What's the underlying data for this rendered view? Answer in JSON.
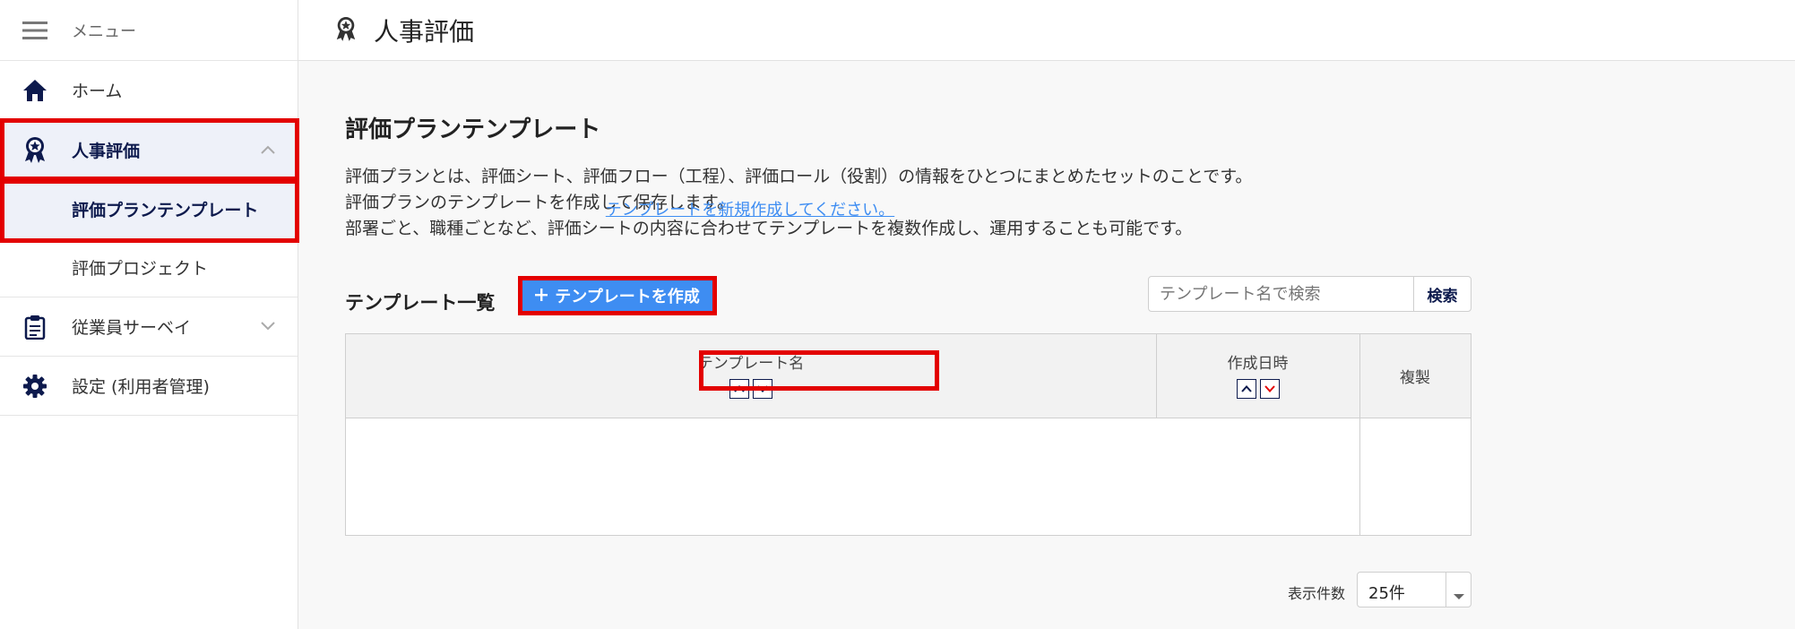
{
  "sidebar": {
    "menu_label": "メニュー",
    "items": [
      {
        "label": "ホーム",
        "icon": "home-icon"
      },
      {
        "label": "人事評価",
        "icon": "award-icon"
      },
      {
        "label": "評価プランテンプレート"
      },
      {
        "label": "評価プロジェクト"
      },
      {
        "label": "従業員サーベイ",
        "icon": "clipboard-icon"
      },
      {
        "label": "設定 (利用者管理)",
        "icon": "gear-icon"
      }
    ]
  },
  "header": {
    "title": "人事評価",
    "icon": "award-icon"
  },
  "main": {
    "title": "評価プランテンプレート",
    "description": [
      "評価プランとは、評価シート、評価フロー（工程）、評価ロール（役割）の情報をひとつにまとめたセットのことです。",
      "評価プランのテンプレートを作成して保存します。",
      "部署ごと、職種ごとなど、評価シートの内容に合わせてテンプレートを複数作成し、運用することも可能です。"
    ],
    "list_title": "テンプレート一覧",
    "create_button": "テンプレートを作成",
    "search": {
      "placeholder": "テンプレート名で検索",
      "button": "検索"
    },
    "table": {
      "columns": [
        "テンプレート名",
        "作成日時",
        "複製"
      ],
      "empty_message": "テンプレートを新規作成してください。"
    },
    "pagination": {
      "label": "表示件数",
      "value": "25件"
    }
  },
  "colors": {
    "accent": "#3e8df2",
    "navy": "#0d1a4d",
    "highlight": "#e30000",
    "sort_active": "#e30000"
  }
}
